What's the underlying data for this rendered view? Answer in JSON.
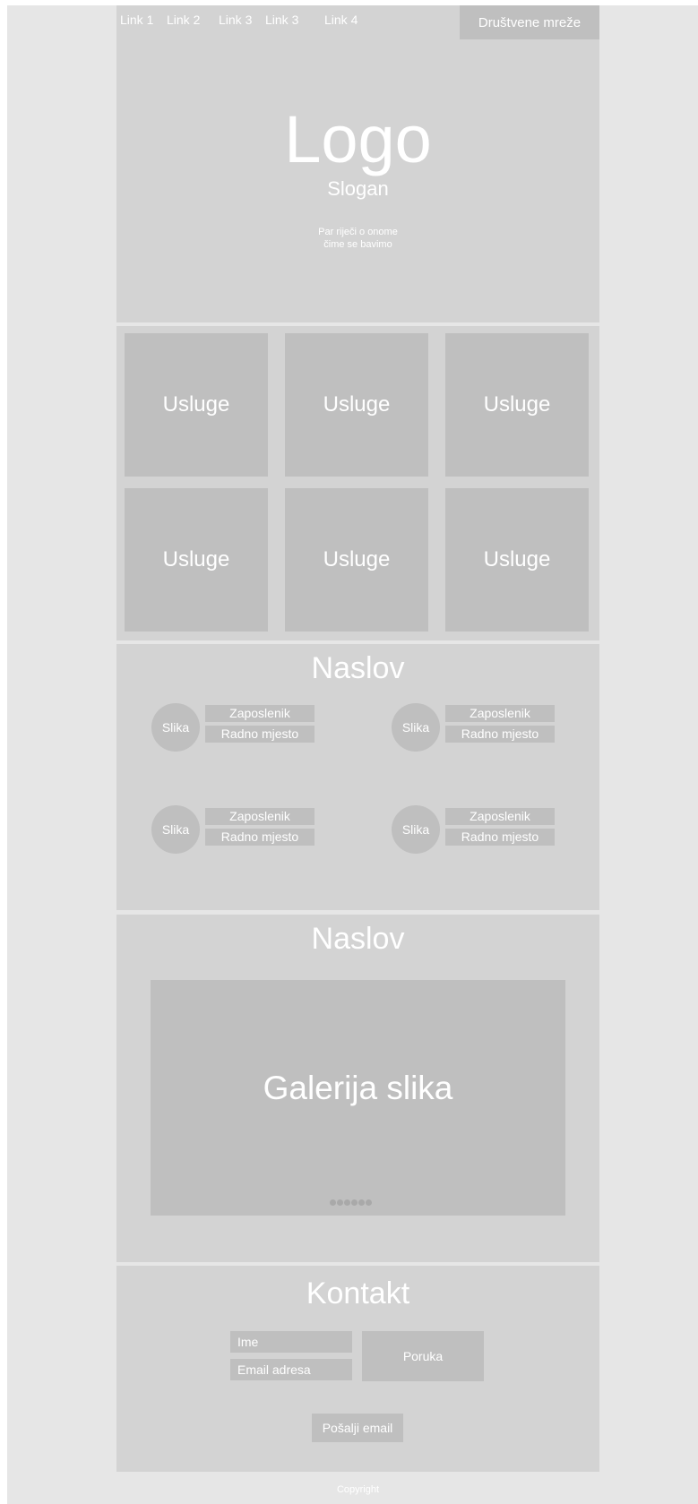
{
  "nav": {
    "links": [
      "Link 1",
      "Link 2",
      "Link 3",
      "Link 3",
      "Link 4"
    ],
    "social": "Društvene mreže"
  },
  "hero": {
    "logo": "Logo",
    "slogan": "Slogan",
    "tagline_line1": "Par riječi o onome",
    "tagline_line2": "čime se bavimo"
  },
  "services": {
    "items": [
      "Usluge",
      "Usluge",
      "Usluge",
      "Usluge",
      "Usluge",
      "Usluge"
    ]
  },
  "team": {
    "title": "Naslov",
    "members": [
      {
        "photo": "Slika",
        "name": "Zaposlenik",
        "role": "Radno mjesto"
      },
      {
        "photo": "Slika",
        "name": "Zaposlenik",
        "role": "Radno mjesto"
      },
      {
        "photo": "Slika",
        "name": "Zaposlenik",
        "role": "Radno mjesto"
      },
      {
        "photo": "Slika",
        "name": "Zaposlenik",
        "role": "Radno mjesto"
      }
    ]
  },
  "gallery": {
    "title": "Naslov",
    "label": "Galerija slika"
  },
  "contact": {
    "title": "Kontakt",
    "name_field": "Ime",
    "email_field": "Email adresa",
    "message_field": "Poruka",
    "send_button": "Pošalji email"
  },
  "footer": {
    "copyright": "Copyright"
  },
  "colors": {
    "page_bg": "#e6e6e6",
    "panel_bg": "#d3d3d3",
    "block_bg": "#bfbfbf",
    "text": "#ffffff"
  }
}
